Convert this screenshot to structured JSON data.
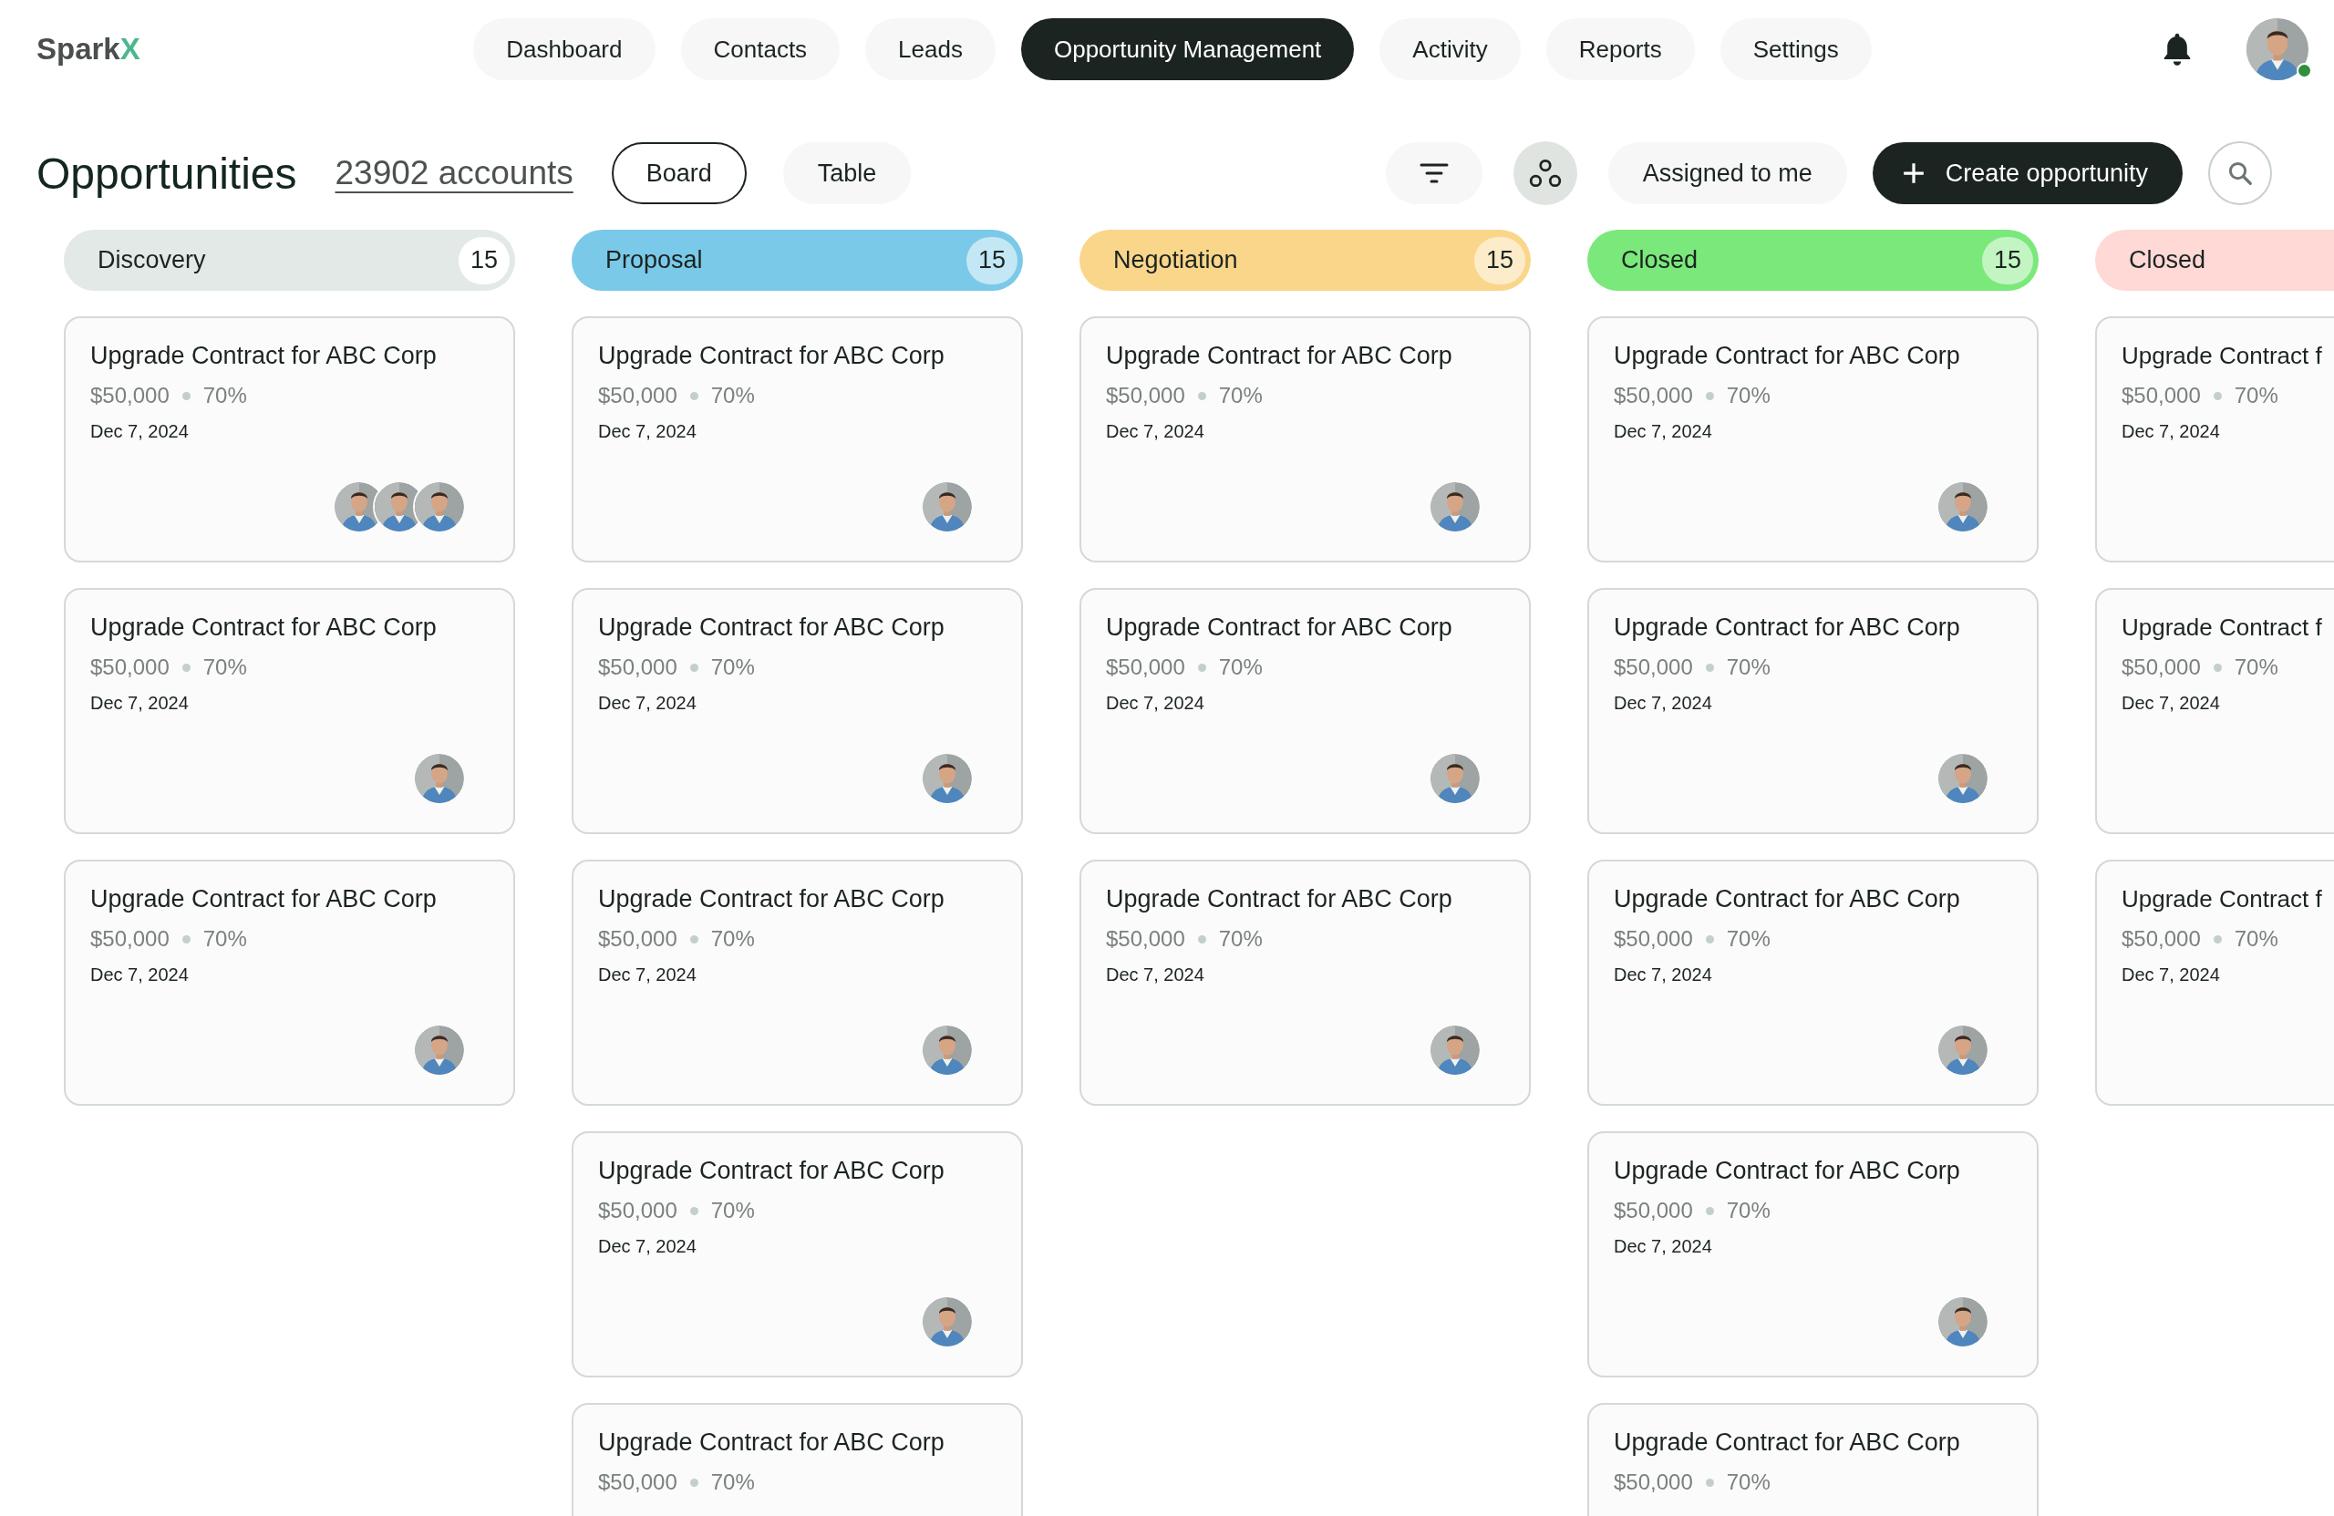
{
  "logo": {
    "name": "Spark",
    "accent": "X"
  },
  "nav": [
    {
      "label": "Dashboard",
      "selected": false
    },
    {
      "label": "Contacts",
      "selected": false
    },
    {
      "label": "Leads",
      "selected": false
    },
    {
      "label": "Opportunity Management",
      "selected": true
    },
    {
      "label": "Activity",
      "selected": false
    },
    {
      "label": "Reports",
      "selected": false
    },
    {
      "label": "Settings",
      "selected": false
    }
  ],
  "user": {
    "online": true
  },
  "page": {
    "title": "Opportunities",
    "count": "23902 accounts"
  },
  "views": [
    {
      "label": "Board",
      "selected": true
    },
    {
      "label": "Table",
      "selected": false
    }
  ],
  "actions": {
    "assigned": "Assigned to me",
    "create": "Create opportunity"
  },
  "columns": [
    {
      "title": "Discovery",
      "count": "15",
      "color": "#e3e9e6",
      "cards": [
        {
          "title": "Upgrade Contract for ABC Corp",
          "amount": "$50,000",
          "probability": "70%",
          "date": "Dec 7, 2024"
        },
        {
          "title": "Upgrade Contract for ABC Corp",
          "amount": "$50,000",
          "probability": "70%",
          "date": "Dec 7, 2024"
        },
        {
          "title": "Upgrade Contract for ABC Corp",
          "amount": "$50,000",
          "probability": "70%",
          "date": "Dec 7, 2024"
        }
      ]
    },
    {
      "title": "Proposal",
      "count": "15",
      "color": "#7ac9e8",
      "cards": [
        {
          "title": "Upgrade Contract for ABC Corp",
          "amount": "$50,000",
          "probability": "70%",
          "date": "Dec 7, 2024"
        },
        {
          "title": "Upgrade Contract for ABC Corp",
          "amount": "$50,000",
          "probability": "70%",
          "date": "Dec 7, 2024"
        },
        {
          "title": "Upgrade Contract for ABC Corp",
          "amount": "$50,000",
          "probability": "70%",
          "date": "Dec 7, 2024"
        },
        {
          "title": "Upgrade Contract for ABC Corp",
          "amount": "$50,000",
          "probability": "70%",
          "date": "Dec 7, 2024"
        },
        {
          "title": "Upgrade Contract for ABC Corp",
          "amount": "$50,000",
          "probability": "70%"
        }
      ]
    },
    {
      "title": "Negotiation",
      "count": "15",
      "color": "#fad68a",
      "cards": [
        {
          "title": "Upgrade Contract for ABC Corp",
          "amount": "$50,000",
          "probability": "70%",
          "date": "Dec 7, 2024"
        },
        {
          "title": "Upgrade Contract for ABC Corp",
          "amount": "$50,000",
          "probability": "70%",
          "date": "Dec 7, 2024"
        },
        {
          "title": "Upgrade Contract for ABC Corp",
          "amount": "$50,000",
          "probability": "70%",
          "date": "Dec 7, 2024"
        }
      ]
    },
    {
      "title": "Closed",
      "count": "15",
      "color": "#7be87b",
      "cards": [
        {
          "title": "Upgrade Contract for ABC Corp",
          "amount": "$50,000",
          "probability": "70%",
          "date": "Dec 7, 2024"
        },
        {
          "title": "Upgrade Contract for ABC Corp",
          "amount": "$50,000",
          "probability": "70%",
          "date": "Dec 7, 2024"
        },
        {
          "title": "Upgrade Contract for ABC Corp",
          "amount": "$50,000",
          "probability": "70%",
          "date": "Dec 7, 2024"
        },
        {
          "title": "Upgrade Contract for ABC Corp",
          "amount": "$50,000",
          "probability": "70%",
          "date": "Dec 7, 2024"
        },
        {
          "title": "Upgrade Contract for ABC Corp",
          "amount": "$50,000",
          "probability": "70%"
        }
      ]
    },
    {
      "title": "Closed",
      "color": "#ffd9d6",
      "cards": [
        {
          "title": "Upgrade Contract f",
          "amount": "$50,000",
          "probability": "70%",
          "date": "Dec 7, 2024"
        },
        {
          "title": "Upgrade Contract f",
          "amount": "$50,000",
          "probability": "70%",
          "date": "Dec 7, 2024"
        },
        {
          "title": "Upgrade Contract f",
          "amount": "$50,000",
          "probability": "70%",
          "date": "Dec 7, 2024"
        }
      ]
    }
  ]
}
